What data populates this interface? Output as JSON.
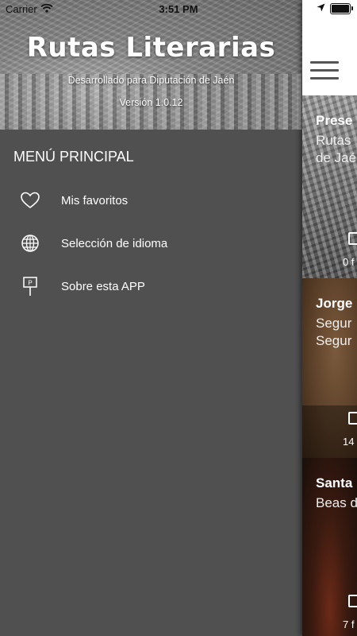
{
  "status_bar": {
    "carrier": "Carrier",
    "time": "3:51 PM"
  },
  "drawer": {
    "app_title": "Rutas Literarias",
    "subtitle": "Desarrollado para Diputación de Jaén",
    "version": "Versión 1.0.12",
    "menu_heading": "MENÚ PRINCIPAL",
    "items": [
      {
        "label": "Mis favoritos",
        "icon": "heart-icon"
      },
      {
        "label": "Selección de idioma",
        "icon": "globe-icon"
      },
      {
        "label": "Sobre esta APP",
        "icon": "signpost-icon"
      }
    ]
  },
  "main": {
    "cards": [
      {
        "title": "Prese",
        "lines": [
          "Rutas",
          "de Jaé"
        ],
        "photo_count": "0 f"
      },
      {
        "title": "Jorge",
        "lines": [
          "Segur",
          "Segur"
        ],
        "photo_count": "14 f"
      },
      {
        "title": "Santa",
        "lines": [
          "Beas d"
        ],
        "photo_count": "7 f"
      }
    ]
  }
}
